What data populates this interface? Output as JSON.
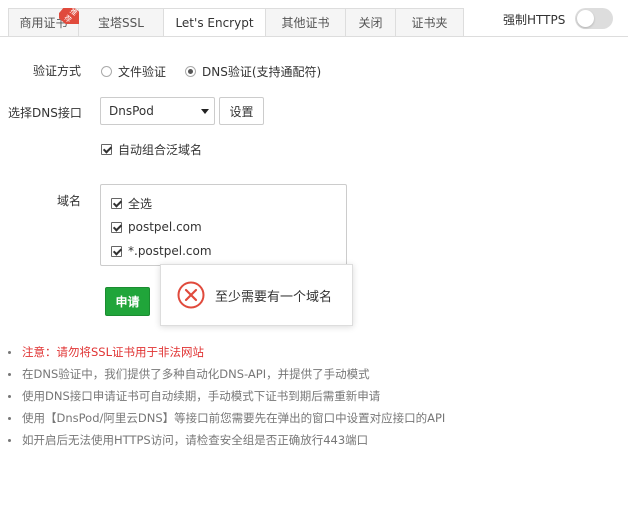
{
  "tabs": [
    {
      "label": "商用证书",
      "badge": "推荐",
      "active": false
    },
    {
      "label": "宝塔SSL",
      "active": false
    },
    {
      "label": "Let's Encrypt",
      "active": true
    },
    {
      "label": "其他证书",
      "active": false
    },
    {
      "label": "关闭",
      "active": false
    },
    {
      "label": "证书夹",
      "active": false
    }
  ],
  "force_https": {
    "label": "强制HTTPS",
    "enabled": false
  },
  "verify": {
    "label": "验证方式",
    "options": [
      {
        "label": "文件验证",
        "selected": false
      },
      {
        "label": "DNS验证(支持通配符)",
        "selected": true
      }
    ]
  },
  "dns": {
    "label": "选择DNS接口",
    "selected": "DnsPod",
    "settings_label": "设置"
  },
  "auto_wildcard": {
    "label": "自动组合泛域名",
    "checked": true
  },
  "domains": {
    "label": "域名",
    "items": [
      {
        "label": "全选",
        "checked": true
      },
      {
        "label": "postpel.com",
        "checked": true
      },
      {
        "label": "*.postpel.com",
        "checked": true
      }
    ]
  },
  "apply_label": "申请",
  "toast": {
    "message": "至少需要有一个域名",
    "icon": "error-circle-icon"
  },
  "notes": [
    "注意：请勿将SSL证书用于非法网站",
    "在DNS验证中，我们提供了多种自动化DNS-API，并提供了手动模式",
    "使用DNS接口申请证书可自动续期，手动模式下证书到期后需重新申请",
    "使用【DnsPod/阿里云DNS】等接口前您需要先在弹出的窗口中设置对应接口的API",
    "如开启后无法使用HTTPS访问，请检查安全组是否正确放行443端口"
  ],
  "colors": {
    "primary": "#20a53a",
    "warning": "#e03333",
    "error": "#e04a3c"
  }
}
